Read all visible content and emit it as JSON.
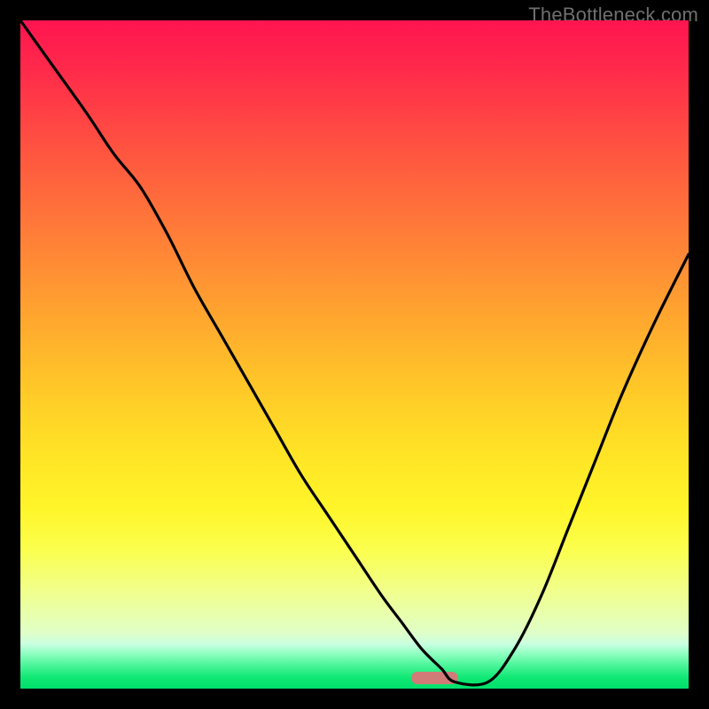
{
  "watermark": "TheBottleneck.com",
  "chart_data": {
    "type": "line",
    "title": "",
    "xlabel": "",
    "ylabel": "",
    "xlim": [
      0,
      100
    ],
    "ylim": [
      0,
      100
    ],
    "grid": false,
    "legend": false,
    "series": [
      {
        "name": "bottleneck-curve",
        "x": [
          0,
          5,
          10,
          14,
          18,
          22,
          26,
          30,
          34,
          38,
          42,
          46,
          50,
          54,
          57,
          60,
          63,
          65,
          70,
          74,
          78,
          82,
          86,
          90,
          95,
          100
        ],
        "y": [
          100,
          93,
          86,
          80,
          75,
          68,
          60,
          53,
          46,
          39,
          32,
          26,
          20,
          14,
          10,
          6,
          3,
          1,
          1,
          6,
          14,
          24,
          34,
          44,
          55,
          65
        ]
      }
    ],
    "marker": {
      "x": 62,
      "width": 7
    },
    "gradient_stops": [
      {
        "pos": 0.0,
        "color": "#ff1450"
      },
      {
        "pos": 0.08,
        "color": "#ff2c4a"
      },
      {
        "pos": 0.2,
        "color": "#ff5640"
      },
      {
        "pos": 0.32,
        "color": "#ff7d38"
      },
      {
        "pos": 0.44,
        "color": "#ffa52f"
      },
      {
        "pos": 0.55,
        "color": "#ffc828"
      },
      {
        "pos": 0.65,
        "color": "#ffe425"
      },
      {
        "pos": 0.73,
        "color": "#fff52a"
      },
      {
        "pos": 0.79,
        "color": "#fbff4c"
      },
      {
        "pos": 0.85,
        "color": "#f2ff88"
      },
      {
        "pos": 0.917,
        "color": "#e0ffc8"
      },
      {
        "pos": 0.917,
        "color": "#e0ffc8"
      },
      {
        "pos": 0.94,
        "color": "#8effc0"
      },
      {
        "pos": 0.97,
        "color": "#34ef88"
      },
      {
        "pos": 1.0,
        "color": "#00e06a"
      }
    ]
  }
}
